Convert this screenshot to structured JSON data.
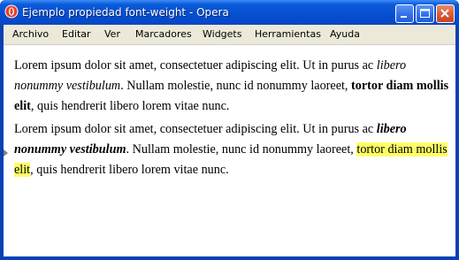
{
  "window": {
    "title": "Ejemplo propiedad font-weight - Opera"
  },
  "titlebar_buttons": {
    "minimize": "minimize-icon",
    "maximize": "maximize-icon",
    "close": "close-icon"
  },
  "menu": {
    "items": [
      "Archivo",
      "Editar",
      "Ver",
      "Marcadores",
      "Widgets",
      "Herramientas",
      "Ayuda"
    ]
  },
  "paragraph1": {
    "t1": "Lorem ipsum dolor sit amet, consectetuer adipiscing elit. Ut in purus ac ",
    "italic": "libero nonummy vestibulum",
    "t2": ". Nullam molestie, nunc id nonummy laoreet, ",
    "bold": "tortor diam mollis elit",
    "t3": ", quis hendrerit libero lorem vitae nunc."
  },
  "paragraph2": {
    "t1": "Lorem ipsum dolor sit amet, consectetuer adipiscing elit. Ut in purus ac ",
    "bold_italic": "libero nonummy vestibulum",
    "t2": ". Nullam molestie, nunc id nonummy laoreet, ",
    "highlight": "tortor diam mollis elit",
    "t3": ", quis hendrerit libero lorem vitae nunc."
  },
  "colors": {
    "titlebar": "#0550d1",
    "highlight": "#ffff66",
    "menubar": "#ece9d8"
  }
}
